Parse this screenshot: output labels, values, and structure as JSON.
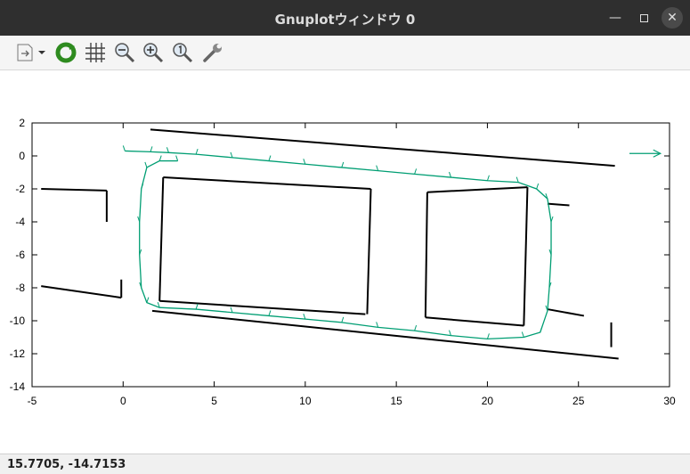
{
  "window": {
    "title": "Gnuplotウィンドウ 0",
    "buttons": [
      "minimize",
      "maximize",
      "close"
    ]
  },
  "toolbar": {
    "items": [
      {
        "icon": "export-icon"
      },
      {
        "icon": "dropdown-arrow-icon"
      },
      {
        "icon": "replot-icon"
      },
      {
        "icon": "grid-icon"
      },
      {
        "icon": "zoom-out-icon"
      },
      {
        "icon": "zoom-in-icon"
      },
      {
        "icon": "zoom-reset-icon"
      },
      {
        "icon": "settings-wrench-icon"
      }
    ]
  },
  "statusbar": {
    "coords": "15.7705, -14.7153"
  },
  "colors": {
    "path": "#009e73",
    "map": "#000000",
    "titlebar": "#2f2f2f"
  },
  "chart_data": {
    "type": "scatter",
    "title": "",
    "xlabel": "",
    "ylabel": "",
    "xlim": [
      -5,
      30
    ],
    "ylim": [
      -14,
      2
    ],
    "xticks": [
      -5,
      0,
      5,
      10,
      15,
      20,
      25,
      30
    ],
    "yticks": [
      -14,
      -12,
      -10,
      -8,
      -6,
      -4,
      -2,
      0,
      2
    ],
    "grid": false,
    "legend": "none",
    "series": [
      {
        "kind": "map-walls",
        "segments": [
          [
            [
              1.5,
              1.6
            ],
            [
              27.0,
              -0.6
            ]
          ],
          [
            [
              1.6,
              -9.4
            ],
            [
              27.2,
              -12.3
            ]
          ],
          [
            [
              2.2,
              -1.3
            ],
            [
              2.0,
              -8.8
            ]
          ],
          [
            [
              2.0,
              -8.8
            ],
            [
              13.3,
              -9.6
            ]
          ],
          [
            [
              2.2,
              -1.3
            ],
            [
              13.6,
              -2.0
            ]
          ],
          [
            [
              13.6,
              -2.0
            ],
            [
              13.4,
              -9.6
            ]
          ],
          [
            [
              16.7,
              -2.2
            ],
            [
              22.2,
              -1.9
            ]
          ],
          [
            [
              16.7,
              -2.2
            ],
            [
              16.6,
              -9.8
            ]
          ],
          [
            [
              16.6,
              -9.8
            ],
            [
              22.0,
              -10.3
            ]
          ],
          [
            [
              22.2,
              -1.9
            ],
            [
              22.0,
              -10.3
            ]
          ],
          [
            [
              -4.5,
              -2.0
            ],
            [
              -0.9,
              -2.1
            ]
          ],
          [
            [
              -4.5,
              -7.9
            ],
            [
              -0.1,
              -8.6
            ]
          ],
          [
            [
              -0.9,
              -2.1
            ],
            [
              -0.9,
              -4.0
            ]
          ],
          [
            [
              -0.1,
              -7.5
            ],
            [
              -0.1,
              -8.6
            ]
          ],
          [
            [
              23.3,
              -2.9
            ],
            [
              24.5,
              -3.0
            ]
          ],
          [
            [
              23.3,
              -9.3
            ],
            [
              25.3,
              -9.7
            ]
          ],
          [
            [
              26.8,
              -11.6
            ],
            [
              26.8,
              -10.1
            ]
          ]
        ]
      },
      {
        "kind": "trajectory-arrows",
        "points": [
          [
            0.1,
            0.3
          ],
          [
            1.5,
            0.25
          ],
          [
            2.5,
            0.2
          ],
          [
            4,
            0.1
          ],
          [
            6,
            -0.1
          ],
          [
            8,
            -0.3
          ],
          [
            10,
            -0.5
          ],
          [
            12,
            -0.7
          ],
          [
            14,
            -0.9
          ],
          [
            16,
            -1.1
          ],
          [
            18,
            -1.3
          ],
          [
            20,
            -1.5
          ],
          [
            21.7,
            -1.6
          ],
          [
            22.7,
            -2.0
          ],
          [
            23.3,
            -2.6
          ],
          [
            23.5,
            -4
          ],
          [
            23.5,
            -6
          ],
          [
            23.4,
            -8
          ],
          [
            23.3,
            -9.4
          ],
          [
            22.9,
            -10.7
          ],
          [
            22,
            -11.0
          ],
          [
            20,
            -11.1
          ],
          [
            18,
            -10.9
          ],
          [
            16,
            -10.6
          ],
          [
            14,
            -10.4
          ],
          [
            12,
            -10.1
          ],
          [
            10,
            -9.9
          ],
          [
            8,
            -9.7
          ],
          [
            6,
            -9.5
          ],
          [
            4,
            -9.3
          ],
          [
            2,
            -9.2
          ],
          [
            1.3,
            -8.9
          ],
          [
            1.0,
            -8
          ],
          [
            0.9,
            -6
          ],
          [
            0.9,
            -4
          ],
          [
            1.0,
            -2
          ],
          [
            1.3,
            -0.7
          ],
          [
            2.0,
            -0.3
          ],
          [
            3.0,
            -0.3
          ]
        ]
      },
      {
        "kind": "goal-arrow",
        "points": [
          [
            27.8,
            0.15
          ],
          [
            29.5,
            0.15
          ]
        ]
      }
    ]
  }
}
